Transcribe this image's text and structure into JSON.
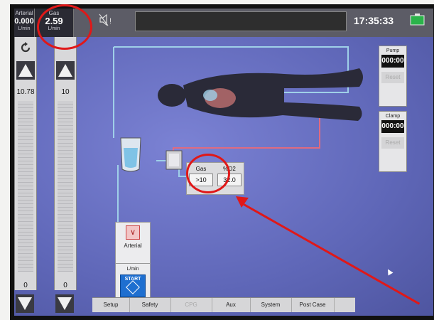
{
  "readouts": {
    "arterial": {
      "label": "Arterial",
      "value": "0.000",
      "unit": "L/min"
    },
    "gas": {
      "label": "Gas",
      "value": "2.59",
      "unit": "L/min"
    }
  },
  "clock": "17:35:33",
  "strips": {
    "arterial": {
      "setting": "10.78",
      "min": "0"
    },
    "gas": {
      "setting": "10",
      "min": "0"
    }
  },
  "pump_box": {
    "label": "Pump",
    "time": "000:00",
    "reset": "Reset"
  },
  "clamp_box": {
    "label": "Clamp",
    "time": "000:00",
    "reset": "Reset"
  },
  "gas_panel": {
    "gas": {
      "label": "Gas",
      "value": ">10"
    },
    "fio2": {
      "label": "%O2",
      "value": "32.0"
    }
  },
  "arterial_box": {
    "label": "Arterial",
    "unit": "L/min",
    "start": "START"
  },
  "tabs": [
    {
      "label": "Setup",
      "enabled": true
    },
    {
      "label": "Safety",
      "enabled": true
    },
    {
      "label": "CPG",
      "enabled": false
    },
    {
      "label": "Aux",
      "enabled": true
    },
    {
      "label": "System",
      "enabled": true
    },
    {
      "label": "Post Case",
      "enabled": true
    }
  ],
  "colors": {
    "screen_bg": "#6b73c6",
    "annotation": "#e01818",
    "start_button": "#1e6fd0",
    "arterial_line": "#e06b80",
    "venous_line": "#9fd0e8"
  }
}
